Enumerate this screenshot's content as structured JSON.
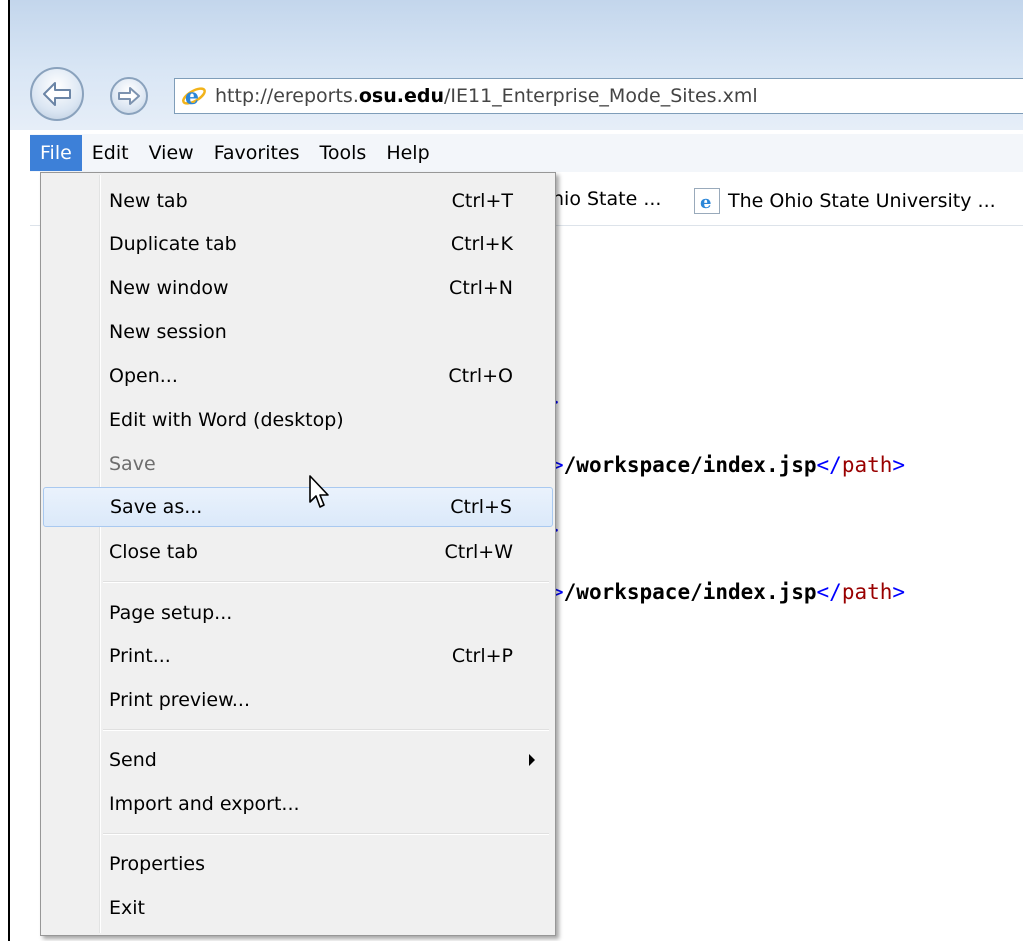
{
  "browser": {
    "url_prefix": "http://ereports.",
    "url_domain": "osu.edu",
    "url_suffix": "/IE11_Enterprise_Mode_Sites.xml"
  },
  "menubar": [
    "File",
    "Edit",
    "View",
    "Favorites",
    "Tools",
    "Help"
  ],
  "favorites": {
    "item1": "hio State ...",
    "item2": "The Ohio State University ..."
  },
  "content": {
    "fragment_bracket": ">",
    "line_open": ">",
    "line_value": "/workspace/index.jsp",
    "line_close_open": "</",
    "line_tag": "path",
    "line_close_end": ">"
  },
  "file_menu": {
    "new_tab": {
      "label": "New tab",
      "shortcut": "Ctrl+T"
    },
    "duplicate_tab": {
      "label": "Duplicate tab",
      "shortcut": "Ctrl+K"
    },
    "new_window": {
      "label": "New window",
      "shortcut": "Ctrl+N"
    },
    "new_session": {
      "label": "New session"
    },
    "open": {
      "label": "Open...",
      "shortcut": "Ctrl+O"
    },
    "edit_with_word": {
      "label": "Edit with Word (desktop)"
    },
    "save": {
      "label": "Save"
    },
    "save_as": {
      "label": "Save as...",
      "shortcut": "Ctrl+S"
    },
    "close_tab": {
      "label": "Close tab",
      "shortcut": "Ctrl+W"
    },
    "page_setup": {
      "label": "Page setup..."
    },
    "print": {
      "label": "Print...",
      "shortcut": "Ctrl+P"
    },
    "print_preview": {
      "label": "Print preview..."
    },
    "send": {
      "label": "Send"
    },
    "import_export": {
      "label": "Import and export..."
    },
    "properties": {
      "label": "Properties"
    },
    "exit": {
      "label": "Exit"
    }
  }
}
